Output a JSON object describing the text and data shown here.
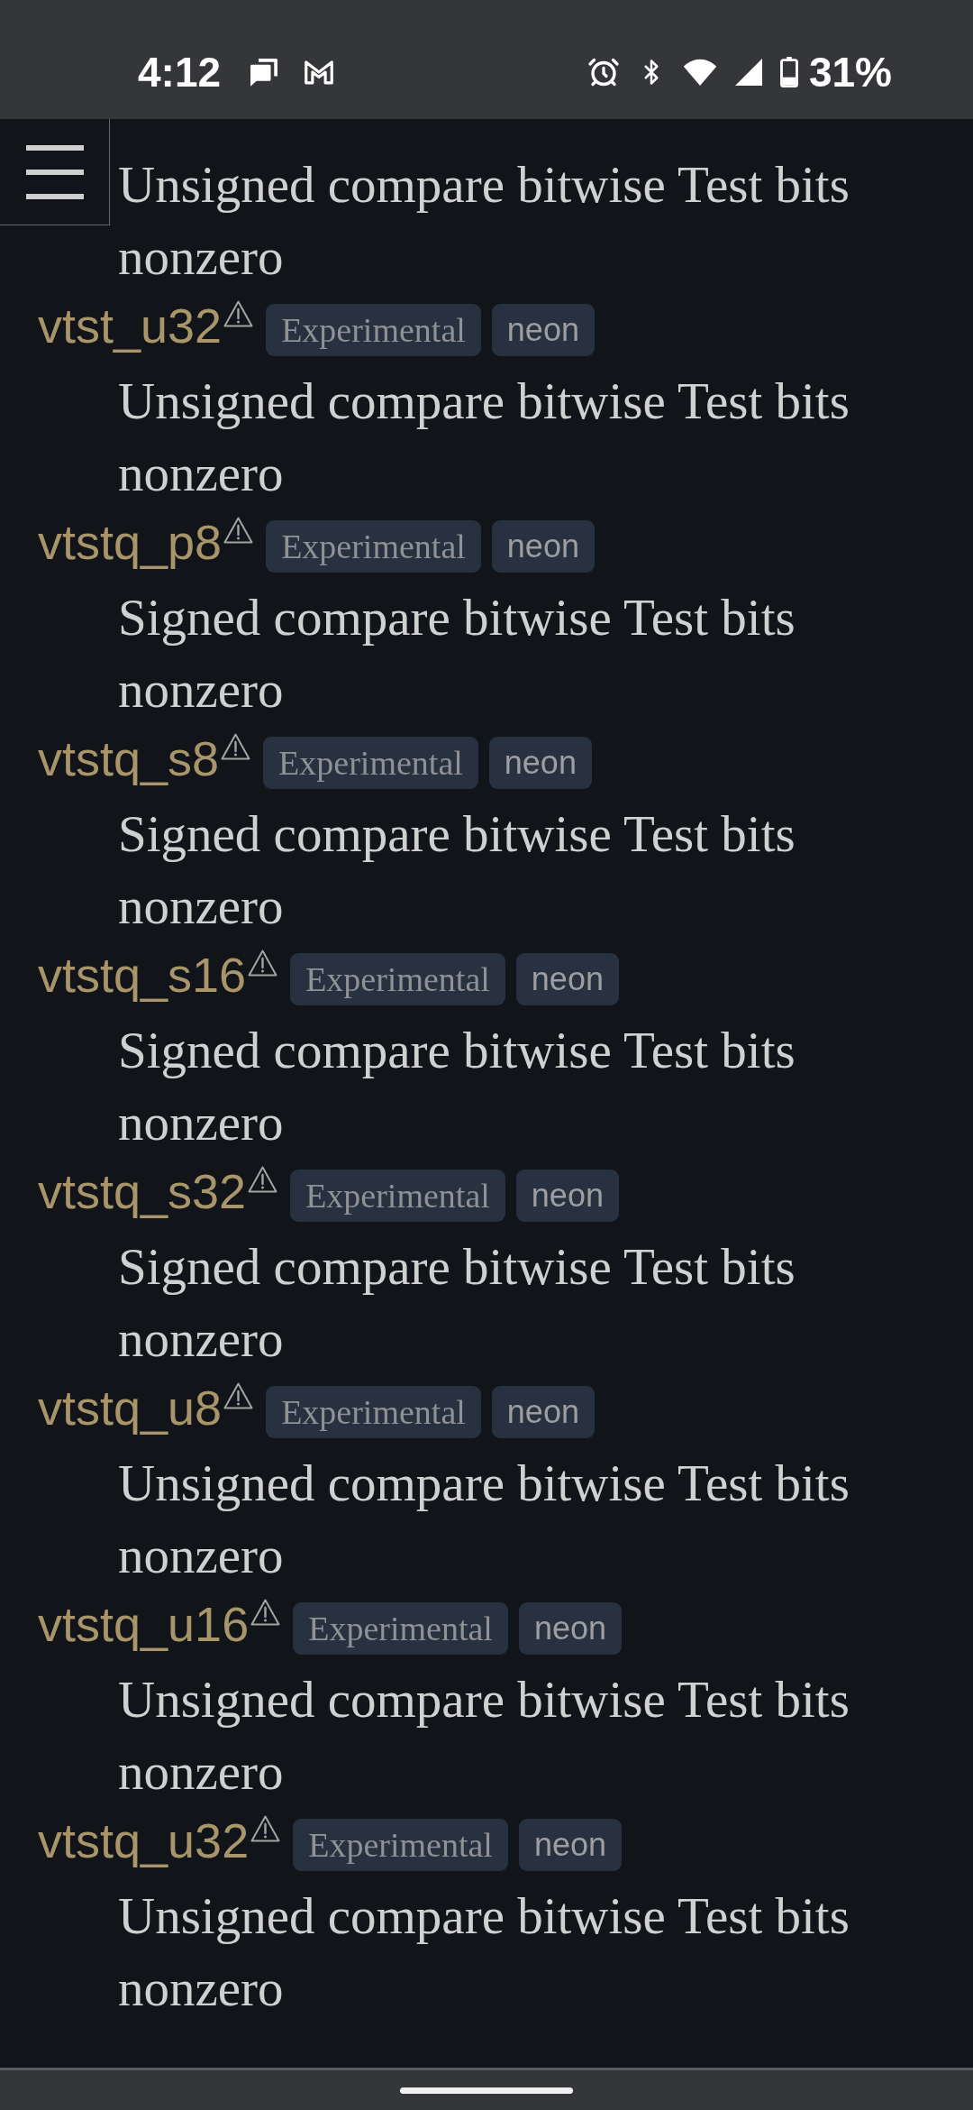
{
  "status_bar": {
    "time": "4:12",
    "battery": "31%"
  },
  "entries": [
    {
      "description": "Unsigned compare bitwise Test bits nonzero"
    },
    {
      "name": "vtst_u32",
      "warning": true,
      "tags": [
        {
          "label": "Experimental",
          "kind": "status"
        },
        {
          "label": "neon",
          "kind": "feature"
        }
      ],
      "description": "Unsigned compare bitwise Test bits nonzero"
    },
    {
      "name": "vtstq_p8",
      "warning": true,
      "tags": [
        {
          "label": "Experimental",
          "kind": "status"
        },
        {
          "label": "neon",
          "kind": "feature"
        }
      ],
      "description": "Signed compare bitwise Test bits nonzero"
    },
    {
      "name": "vtstq_s8",
      "warning": true,
      "tags": [
        {
          "label": "Experimental",
          "kind": "status"
        },
        {
          "label": "neon",
          "kind": "feature"
        }
      ],
      "description": "Signed compare bitwise Test bits nonzero"
    },
    {
      "name": "vtstq_s16",
      "warning": true,
      "tags": [
        {
          "label": "Experimental",
          "kind": "status"
        },
        {
          "label": "neon",
          "kind": "feature"
        }
      ],
      "description": "Signed compare bitwise Test bits nonzero"
    },
    {
      "name": "vtstq_s32",
      "warning": true,
      "tags": [
        {
          "label": "Experimental",
          "kind": "status"
        },
        {
          "label": "neon",
          "kind": "feature"
        }
      ],
      "description": "Signed compare bitwise Test bits nonzero"
    },
    {
      "name": "vtstq_u8",
      "warning": true,
      "tags": [
        {
          "label": "Experimental",
          "kind": "status"
        },
        {
          "label": "neon",
          "kind": "feature"
        }
      ],
      "description": "Unsigned compare bitwise Test bits nonzero"
    },
    {
      "name": "vtstq_u16",
      "warning": true,
      "tags": [
        {
          "label": "Experimental",
          "kind": "status"
        },
        {
          "label": "neon",
          "kind": "feature"
        }
      ],
      "description": "Unsigned compare bitwise Test bits nonzero"
    },
    {
      "name": "vtstq_u32",
      "warning": true,
      "tags": [
        {
          "label": "Experimental",
          "kind": "status"
        },
        {
          "label": "neon",
          "kind": "feature"
        }
      ],
      "description": "Unsigned compare bitwise Test bits nonzero"
    }
  ]
}
